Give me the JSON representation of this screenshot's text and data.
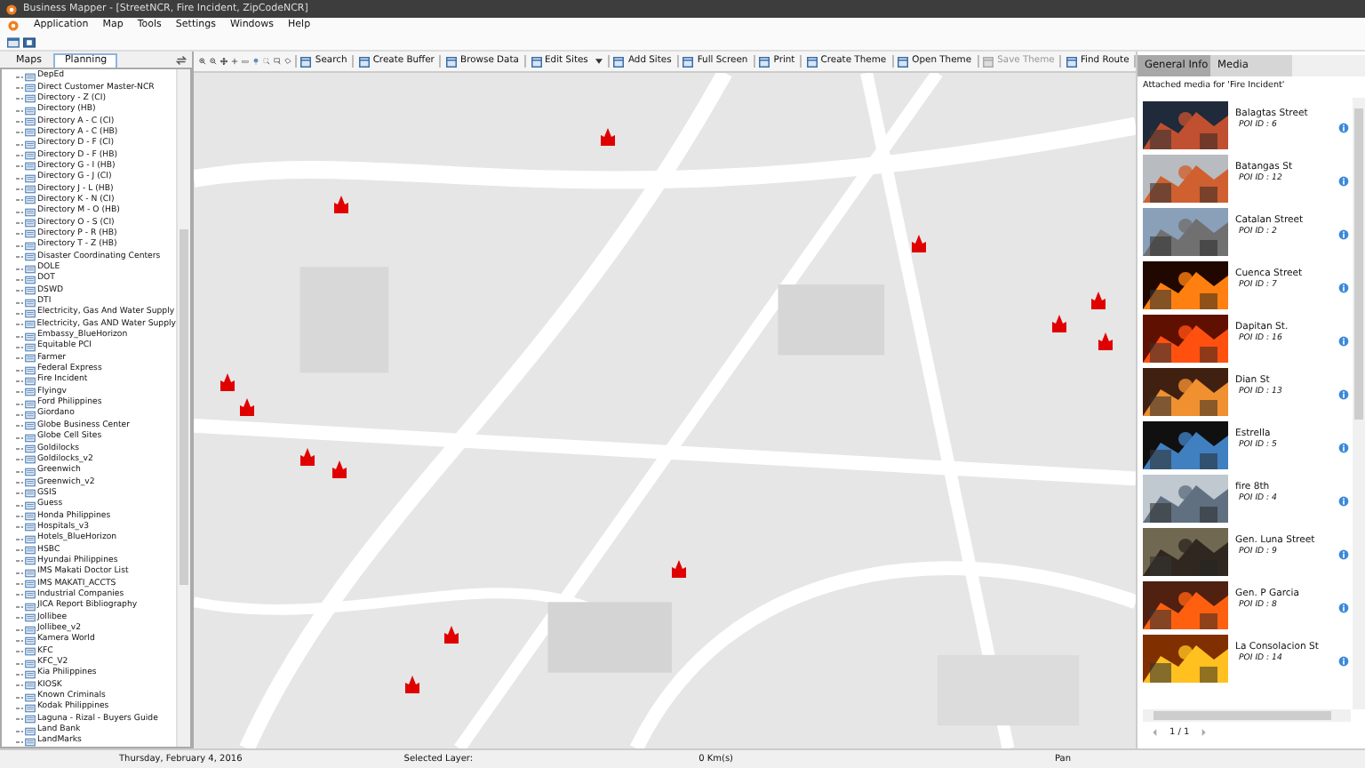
{
  "window": {
    "title": "Business Mapper - [StreetNCR, Fire Incident, ZipCodeNCR]"
  },
  "menu": [
    "Application",
    "Map",
    "Tools",
    "Settings",
    "Windows",
    "Help"
  ],
  "left_tabs": [
    {
      "label": "Maps",
      "selected": false
    },
    {
      "label": "Planning",
      "selected": true
    }
  ],
  "layers": [
    "DepEd",
    "Direct Customer Master-NCR",
    "Directory - Z (CI)",
    "Directory (HB)",
    "Directory A - C (CI)",
    "Directory A - C (HB)",
    "Directory D - F (CI)",
    "Directory D - F (HB)",
    "Directory G - I (HB)",
    "Directory G - J (CI)",
    "Directory J - L (HB)",
    "Directory K - N (CI)",
    "Directory M - O (HB)",
    "Directory O - S (CI)",
    "Directory P - R (HB)",
    "Directory T - Z (HB)",
    "Disaster Coordinating Centers",
    "DOLE",
    "DOT",
    "DSWD",
    "DTI",
    "Electricity, Gas And Water Supply",
    "Electricity, Gas AND Water Supply",
    "Embassy_BlueHorizon",
    "Equitable PCI",
    "Farmer",
    "Federal Express",
    "Fire Incident",
    "Flyingv",
    "Ford Philippines",
    "Giordano",
    "Globe Business Center",
    "Globe Cell Sites",
    "Goldilocks",
    "Goldilocks_v2",
    "Greenwich",
    "Greenwich_v2",
    "GSIS",
    "Guess",
    "Honda Philippines",
    "Hospitals_v3",
    "Hotels_BlueHorizon",
    "HSBC",
    "Hyundai Philippines",
    "IMS Makati Doctor List",
    "IMS MAKATI_ACCTS",
    "Industrial Companies",
    "JICA Report Bibliography",
    "Jollibee",
    "Jollibee_v2",
    "Kamera World",
    "KFC",
    "KFC_V2",
    "Kia Philippines",
    "KIOSK",
    "Known Criminals",
    "Kodak Philippines",
    "Laguna - Rizal - Buyers Guide",
    "Land Bank",
    "LandMarks"
  ],
  "toolbar": [
    {
      "label": "Search",
      "disabled": false,
      "dropdown": false
    },
    {
      "label": "Create Buffer",
      "disabled": false,
      "dropdown": false
    },
    {
      "label": "Browse Data",
      "disabled": false,
      "dropdown": false
    },
    {
      "label": "Edit Sites",
      "disabled": false,
      "dropdown": true
    },
    {
      "label": "Add Sites",
      "disabled": false,
      "dropdown": false
    },
    {
      "label": "Full Screen",
      "disabled": false,
      "dropdown": false
    },
    {
      "label": "Print",
      "disabled": false,
      "dropdown": false
    },
    {
      "label": "Create Theme",
      "disabled": false,
      "dropdown": false
    },
    {
      "label": "Open Theme",
      "disabled": false,
      "dropdown": false
    },
    {
      "label": "Save Theme",
      "disabled": true,
      "dropdown": false
    },
    {
      "label": "Find Route",
      "disabled": false,
      "dropdown": false
    }
  ],
  "right_tabs": [
    {
      "label": "General Info",
      "selected": true
    },
    {
      "label": "Media",
      "selected": false
    }
  ],
  "media_caption": "Attached media for 'Fire Incident'",
  "media": [
    {
      "title": "Balagtas Street",
      "poi": "POI ID : 6"
    },
    {
      "title": "Batangas St",
      "poi": "POI ID : 12"
    },
    {
      "title": "Catalan Street",
      "poi": "POI ID : 2"
    },
    {
      "title": "Cuenca Street",
      "poi": "POI ID : 7"
    },
    {
      "title": "Dapitan St.",
      "poi": "POI ID : 16"
    },
    {
      "title": "Dian St",
      "poi": "POI ID : 13"
    },
    {
      "title": "Estrella",
      "poi": "POI ID : 5"
    },
    {
      "title": "fire 8th",
      "poi": "POI ID : 4"
    },
    {
      "title": "Gen. Luna Street",
      "poi": "POI ID : 9"
    },
    {
      "title": "Gen. P Garcia",
      "poi": "POI ID : 8"
    },
    {
      "title": "La Consolacion St",
      "poi": "POI ID : 14"
    }
  ],
  "pager": "1 / 1",
  "status_bar": {
    "date": "Thursday, February 4, 2016",
    "selected_layer": "Selected Layer:",
    "distance": "0 Km(s)",
    "mode": "Pan"
  }
}
